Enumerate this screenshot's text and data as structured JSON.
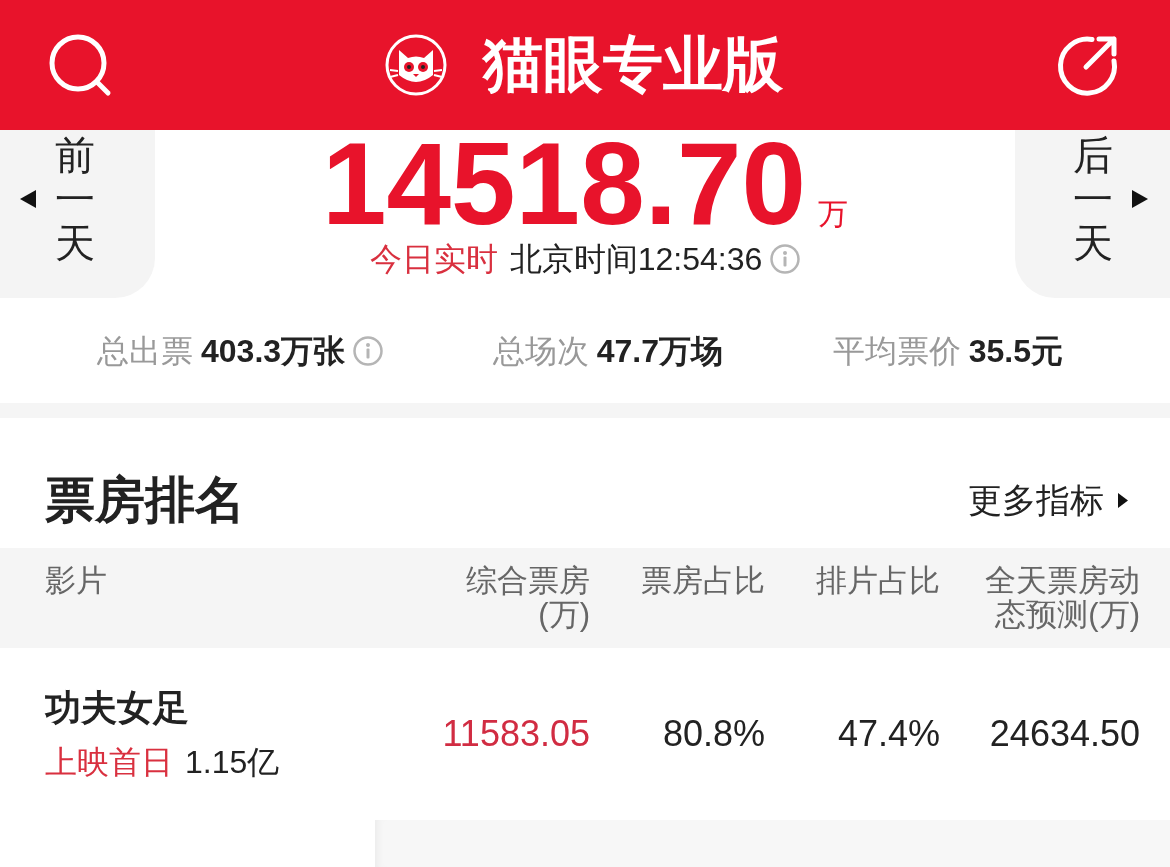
{
  "header": {
    "title": "猫眼专业版"
  },
  "day_nav": [
    {
      "kind": "prev",
      "label": "前一天"
    },
    {
      "kind": "next",
      "label": "后一天"
    }
  ],
  "summary": {
    "total": "14518.70",
    "unit": "万",
    "status": "今日实时",
    "time": "北京时间12:54:36"
  },
  "stats": [
    {
      "label": "总出票",
      "value": "403.3万张",
      "info": true
    },
    {
      "label": "总场次",
      "value": "47.7万场",
      "info": false
    },
    {
      "label": "平均票价",
      "value": "35.5元",
      "info": false
    }
  ],
  "ranking": {
    "title": "票房排名",
    "more": "更多指标",
    "film_header": "影片",
    "columns": [
      {
        "label": "综合票房(万)"
      },
      {
        "label": "票房占比"
      },
      {
        "label": "排片占比"
      },
      {
        "label": "全天票房动态预测(万)"
      }
    ],
    "rows": [
      {
        "film": {
          "title": "功夫女足",
          "tag": "上映首日",
          "tag_value": "1.15亿"
        },
        "cells": [
          "11583.05",
          "80.8%",
          "47.4%",
          "24634.50"
        ]
      }
    ]
  }
}
